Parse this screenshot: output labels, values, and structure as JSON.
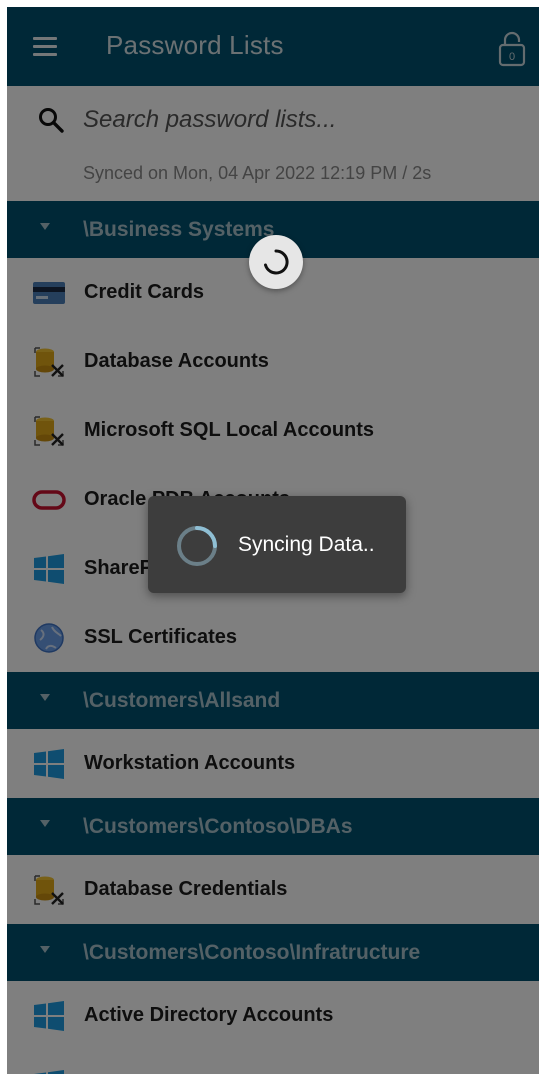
{
  "appbar": {
    "title": "Password Lists",
    "lock_digit": "0"
  },
  "search": {
    "placeholder": "Search password lists..."
  },
  "sync": {
    "status": "Synced on Mon, 04 Apr 2022 12:19 PM / 2s"
  },
  "groups": [
    {
      "title": "\\Business Systems",
      "items": [
        {
          "label": "Credit Cards",
          "icon": "credit-card-icon"
        },
        {
          "label": "Database Accounts",
          "icon": "database-icon"
        },
        {
          "label": "Microsoft SQL Local Accounts",
          "icon": "database-icon"
        },
        {
          "label": "Oracle PDB Accounts",
          "icon": "oracle-icon"
        },
        {
          "label": "SharePoint Accounts",
          "icon": "windows-icon"
        },
        {
          "label": "SSL Certificates",
          "icon": "globe-icon"
        }
      ]
    },
    {
      "title": "\\Customers\\Allsand",
      "items": [
        {
          "label": "Workstation Accounts",
          "icon": "windows-icon"
        }
      ]
    },
    {
      "title": "\\Customers\\Contoso\\DBAs",
      "items": [
        {
          "label": "Database Credentials",
          "icon": "database-icon"
        }
      ]
    },
    {
      "title": "\\Customers\\Contoso\\Infratructure",
      "items": [
        {
          "label": "Active Directory Accounts",
          "icon": "windows-icon"
        }
      ]
    }
  ],
  "overlay": {
    "toast_text": "Syncing Data.."
  },
  "colors": {
    "appbar": "#00506f",
    "group_header": "#00506f",
    "toast": "#3d3d3d",
    "windows_blue": "#1e9be0",
    "oracle_red": "#c8102e"
  }
}
